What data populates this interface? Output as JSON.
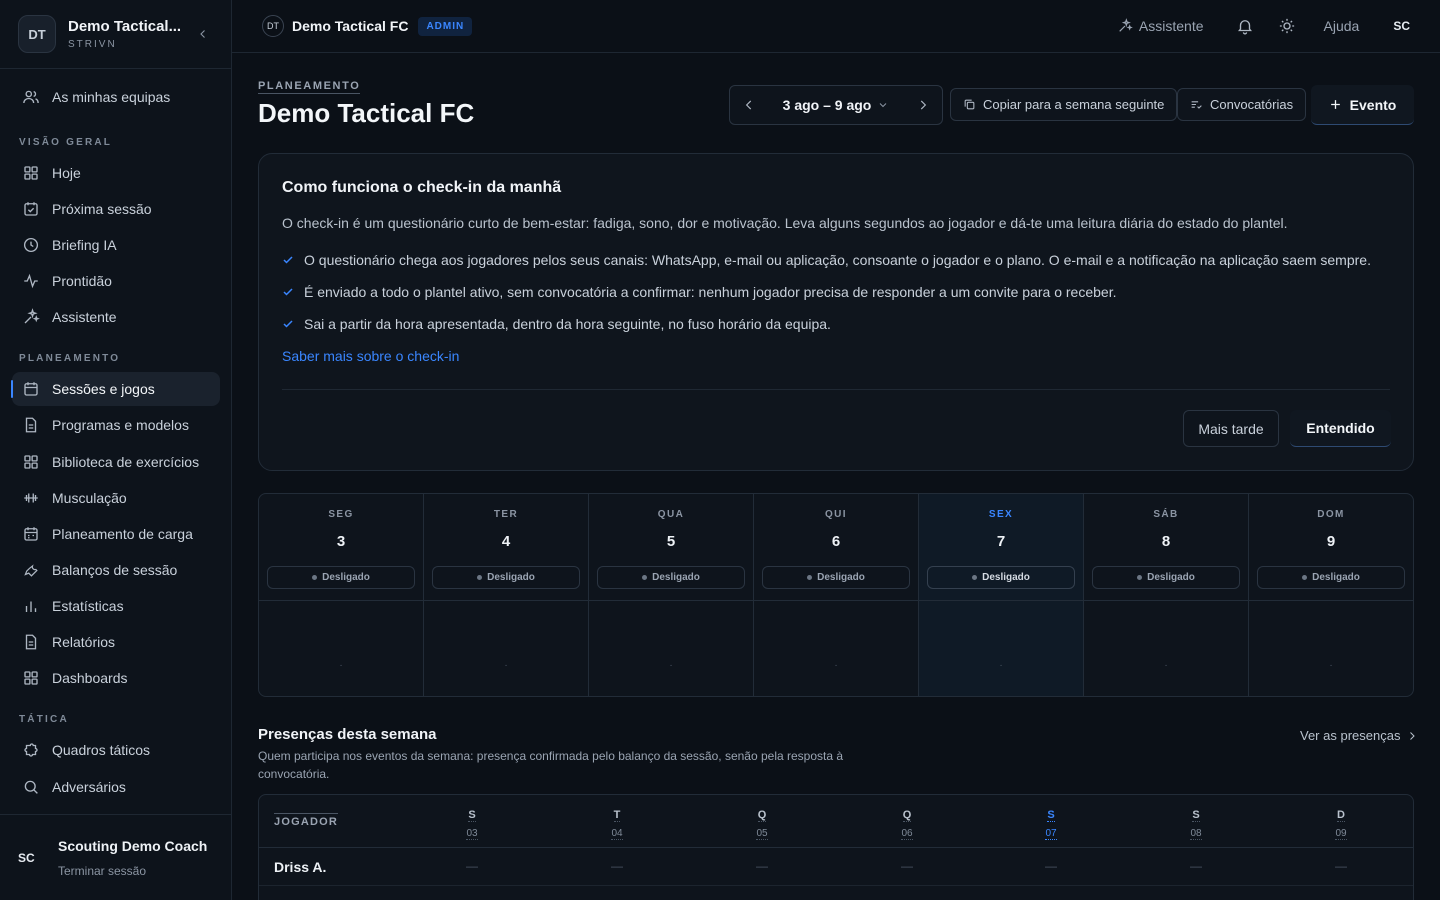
{
  "sidebar": {
    "team_initials": "DT",
    "team_name": "Demo Tactical...",
    "team_sub": "STRIVN",
    "my_teams": "As minhas equipas",
    "sections": {
      "overview": "VISÃO GERAL",
      "planning": "PLANEAMENTO",
      "tactics": "TÁTICA"
    },
    "overview_items": [
      "Hoje",
      "Próxima sessão",
      "Briefing IA",
      "Prontidão",
      "Assistente"
    ],
    "planning_items": [
      "Sessões e jogos",
      "Programas e modelos",
      "Biblioteca de exercícios",
      "Musculação",
      "Planeamento de carga",
      "Balanços de sessão",
      "Estatísticas",
      "Relatórios",
      "Dashboards"
    ],
    "tactics_items": [
      "Quadros táticos",
      "Adversários"
    ],
    "user_initials": "SC",
    "user_name": "Scouting Demo Coach",
    "logout": "Terminar sessão"
  },
  "topbar": {
    "team_initials": "DT",
    "team_name": "Demo Tactical FC",
    "badge": "ADMIN",
    "assistant": "Assistente",
    "help": "Ajuda",
    "user_initials": "SC"
  },
  "header": {
    "eyebrow": "PLANEAMENTO",
    "title": "Demo Tactical FC",
    "week_range": "3 ago – 9 ago",
    "copy_button": "Copiar para a semana seguinte",
    "callups_button": "Convocatórias",
    "event_button": "Evento"
  },
  "info_card": {
    "title": "Como funciona o check-in da manhã",
    "description": "O check-in é um questionário curto de bem-estar: fadiga, sono, dor e motivação. Leva alguns segundos ao jogador e dá-te uma leitura diária do estado do plantel.",
    "points": [
      "O questionário chega aos jogadores pelos seus canais: WhatsApp, e-mail ou aplicação, consoante o jogador e o plano. O e-mail e a notificação na aplicação saem sempre.",
      "É enviado a todo o plantel ativo, sem convocatória a confirmar: nenhum jogador precisa de responder a um convite para o receber.",
      "Sai a partir da hora apresentada, dentro da hora seguinte, no fuso horário da equipa."
    ],
    "link": "Saber mais sobre o check-in",
    "later_button": "Mais tarde",
    "ok_button": "Entendido"
  },
  "week": {
    "days": [
      {
        "abbr": "SEG",
        "num": "3",
        "status": "Desligado",
        "empty": "·"
      },
      {
        "abbr": "TER",
        "num": "4",
        "status": "Desligado",
        "empty": "·"
      },
      {
        "abbr": "QUA",
        "num": "5",
        "status": "Desligado",
        "empty": "·"
      },
      {
        "abbr": "QUI",
        "num": "6",
        "status": "Desligado",
        "empty": "·"
      },
      {
        "abbr": "SEX",
        "num": "7",
        "status": "Desligado",
        "empty": "·"
      },
      {
        "abbr": "SÁB",
        "num": "8",
        "status": "Desligado",
        "empty": "·"
      },
      {
        "abbr": "DOM",
        "num": "9",
        "status": "Desligado",
        "empty": "·"
      }
    ]
  },
  "attendance": {
    "title": "Presenças desta semana",
    "description": "Quem participa nos eventos da semana: presença confirmada pelo balanço da sessão, senão pela resposta à convocatória.",
    "link": "Ver as presenças",
    "player_col": "JOGADOR",
    "days": [
      {
        "l": "S",
        "d": "03"
      },
      {
        "l": "T",
        "d": "04"
      },
      {
        "l": "Q",
        "d": "05"
      },
      {
        "l": "Q",
        "d": "06"
      },
      {
        "l": "S",
        "d": "07"
      },
      {
        "l": "S",
        "d": "08"
      },
      {
        "l": "D",
        "d": "09"
      }
    ],
    "rows": [
      {
        "player": "Driss A.",
        "cells": [
          "—",
          "—",
          "—",
          "—",
          "—",
          "—",
          "—"
        ]
      }
    ]
  },
  "colors": {
    "accent": "#3a86ff",
    "background": "#0b1017"
  }
}
